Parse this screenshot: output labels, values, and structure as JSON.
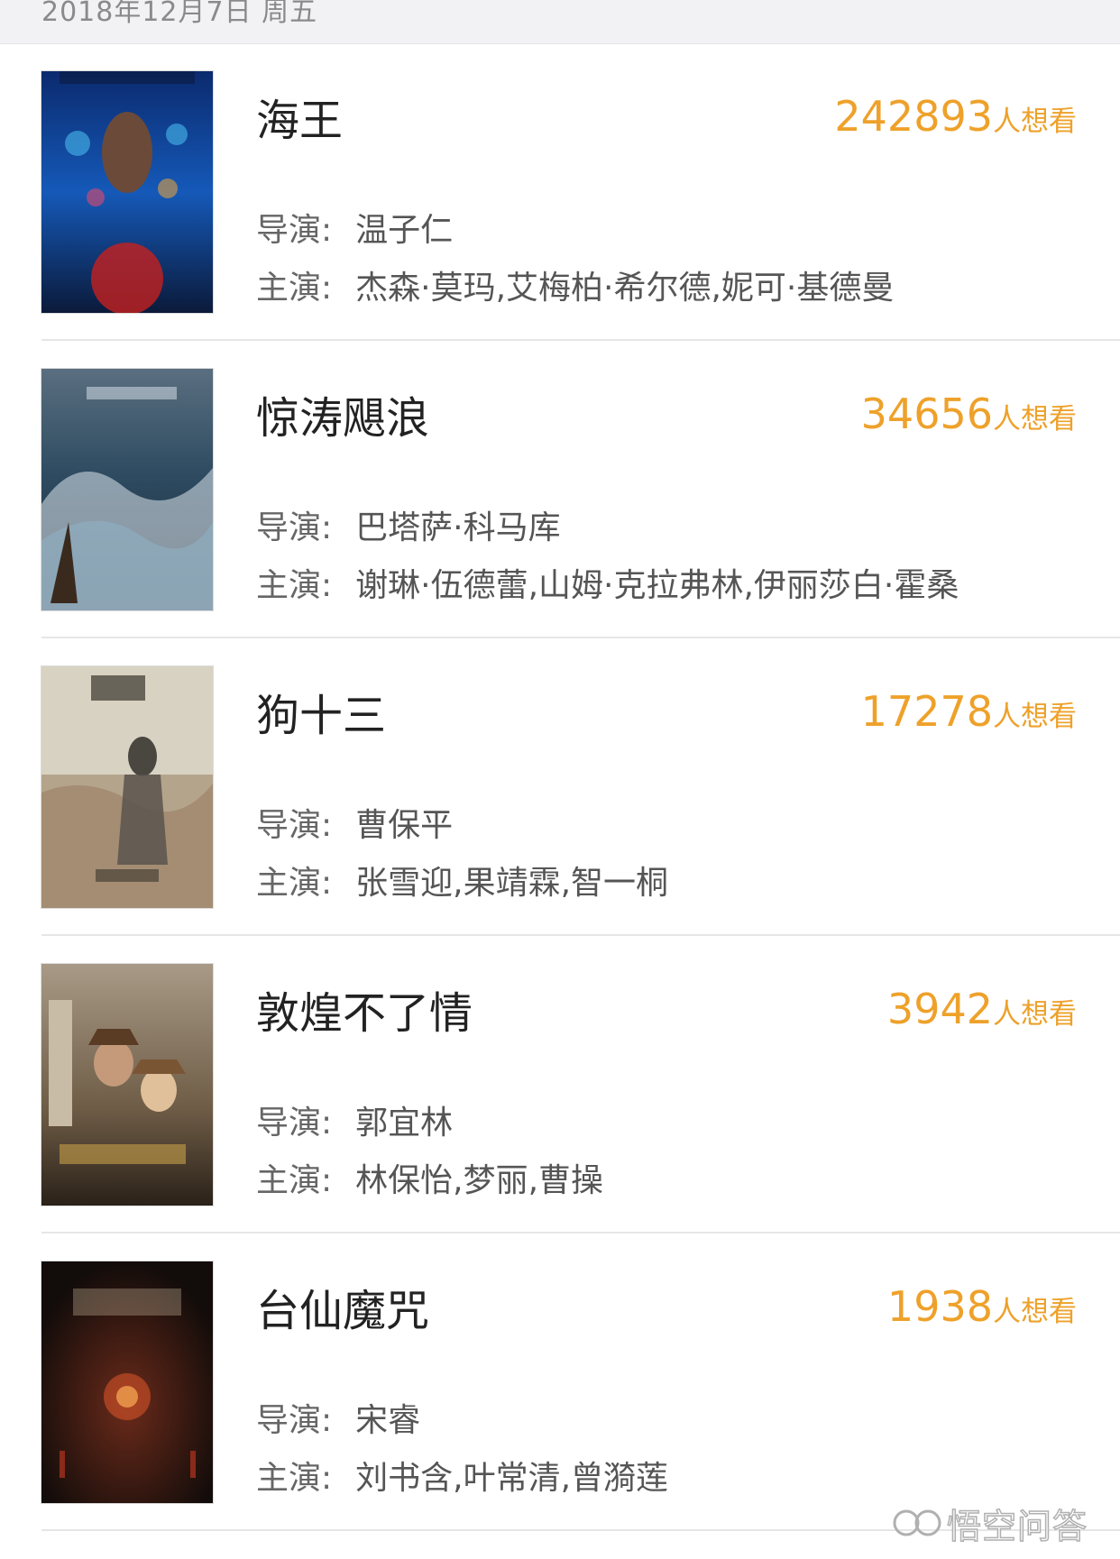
{
  "date_header": "2018年12月7日 周五",
  "accent_color": "#eea12a",
  "want_suffix": "人想看",
  "label_director": "导演:",
  "label_cast": "主演:",
  "movies": [
    {
      "title": "海王",
      "want_count": "242893",
      "director": "温子仁",
      "cast": "杰森·莫玛,艾梅柏·希尔德,妮可·基德曼"
    },
    {
      "title": "惊涛飓浪",
      "want_count": "34656",
      "director": "巴塔萨·科马库",
      "cast": "谢琳·伍德蕾,山姆·克拉弗林,伊丽莎白·霍桑"
    },
    {
      "title": "狗十三",
      "want_count": "17278",
      "director": "曹保平",
      "cast": "张雪迎,果靖霖,智一桐"
    },
    {
      "title": "敦煌不了情",
      "want_count": "3942",
      "director": "郭宜林",
      "cast": "林保怡,梦丽,曹操"
    },
    {
      "title": "台仙魔咒",
      "want_count": "1938",
      "director": "宋睿",
      "cast": "刘书含,叶常清,曾漪莲"
    }
  ],
  "watermark": "悟空问答"
}
